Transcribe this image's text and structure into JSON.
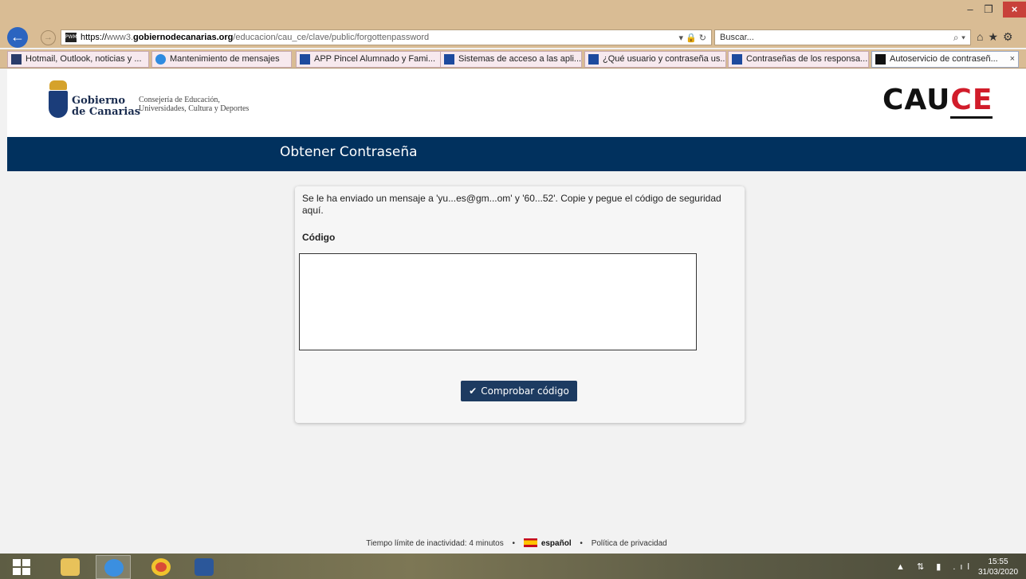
{
  "window": {
    "min": "–",
    "max": "❐",
    "close": "×"
  },
  "browser": {
    "back": "←",
    "forward": "→",
    "favicon": "PWM",
    "url_scheme": "https://",
    "url_pre": "www3.",
    "url_domain": "gobiernodecanarias.org",
    "url_path": "/educacion/cau_ce/clave/public/forgottenpassword",
    "address_icons": "▾ 🔒 ↻",
    "search_placeholder": "Buscar...",
    "search_icon": "⌕ ▾",
    "toolbar_icons": "⌂★⚙"
  },
  "tabs": [
    {
      "label": "Hotmail, Outlook, noticias y ...",
      "icon": "msn-icon"
    },
    {
      "label": "Mantenimiento de mensajes",
      "icon": "ie-icon"
    },
    {
      "label": "APP Pincel Alumnado y Fami...",
      "icon": "gobcan-icon"
    },
    {
      "label": "Sistemas de acceso a las apli...",
      "icon": "gobcan-icon"
    },
    {
      "label": "¿Qué usuario y contraseña us...",
      "icon": "gobcan-icon"
    },
    {
      "label": "Contraseñas de los responsa...",
      "icon": "gobcan-icon"
    },
    {
      "label": "Autoservicio de contraseñ...",
      "icon": "pwm-icon",
      "close": "×"
    }
  ],
  "header": {
    "gov_line1": "Gobierno",
    "gov_line2": "de Canarias",
    "dept_line1": "Consejería de Educación,",
    "dept_line2": "Universidades, Cultura y Deportes",
    "logo_main": "CAU",
    "logo_accent": "CE"
  },
  "page": {
    "title": "Obtener Contraseña",
    "message": "Se le ha enviado un mensaje a 'yu...es@gm...om' y '60...52'. Copie y pegue el código de seguridad aquí.",
    "code_label": "Código",
    "code_value": "",
    "verify_check": "✔",
    "verify_label": "Comprobar código"
  },
  "footer": {
    "timeout": "Tiempo límite de inactividad: 4 minutos",
    "sep": "•",
    "language": "español",
    "privacy": "Política de privacidad"
  },
  "taskbar": {
    "tray": "▲ ⇅ ▮ .ıl",
    "time": "15:55",
    "date": "31/03/2020"
  }
}
